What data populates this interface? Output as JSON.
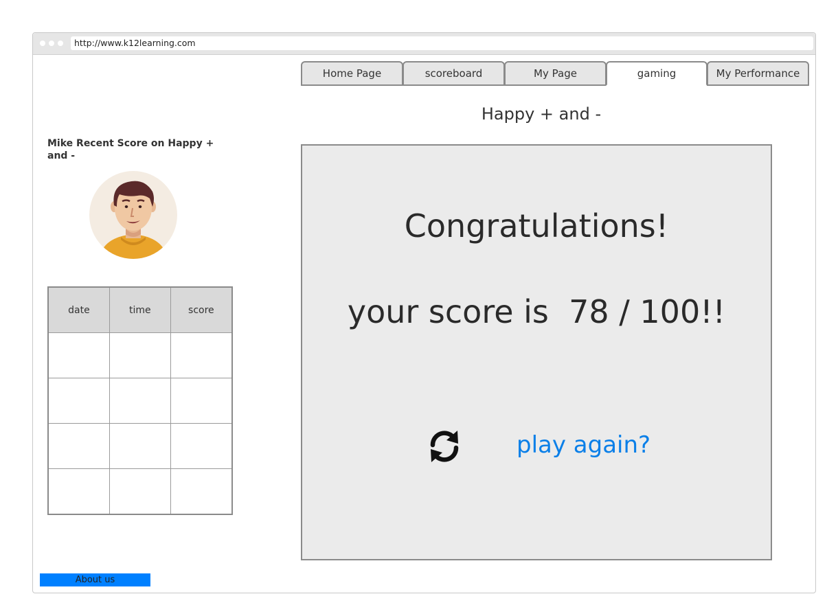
{
  "browser": {
    "url": "http://www.k12learning.com"
  },
  "tabs": [
    {
      "label": "Home Page"
    },
    {
      "label": "scoreboard"
    },
    {
      "label": "My Page"
    },
    {
      "label": "gaming",
      "active": true
    },
    {
      "label": "My Performance"
    }
  ],
  "game": {
    "title": "Happy + and -"
  },
  "sidebar": {
    "recent_title": "Mike Recent Score on Happy + and -",
    "avatar_icon": "user-avatar-icon",
    "table": {
      "headers": [
        "date",
        "time",
        "score"
      ],
      "rows": [
        [
          "",
          "",
          ""
        ],
        [
          "",
          "",
          ""
        ],
        [
          "",
          "",
          ""
        ],
        [
          "",
          "",
          ""
        ]
      ]
    }
  },
  "result": {
    "congrats": "Congratulations!",
    "score_text": "your score is  78 / 100!!",
    "refresh_icon": "refresh-icon",
    "play_again": "play again?"
  },
  "footer": {
    "about": "About us"
  },
  "colors": {
    "link": "#0a7fe8",
    "about_bg": "#0080ff",
    "panel_bg": "#ebebeb"
  }
}
